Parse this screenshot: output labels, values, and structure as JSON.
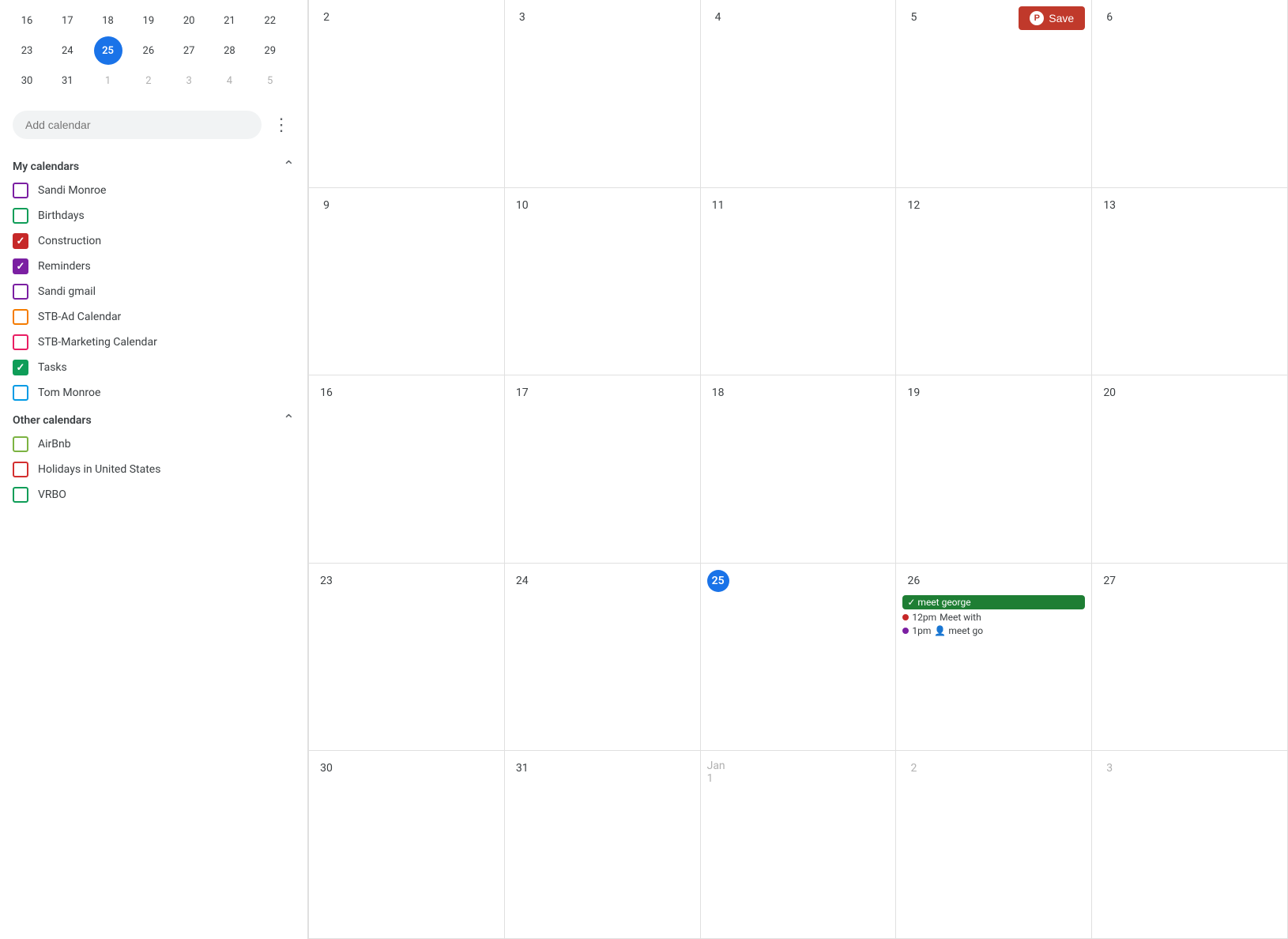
{
  "sidebar": {
    "mini_calendar": {
      "rows": [
        [
          16,
          17,
          18,
          19,
          20,
          21,
          22
        ],
        [
          23,
          24,
          25,
          26,
          27,
          28,
          29
        ],
        [
          30,
          31,
          1,
          2,
          3,
          4,
          5
        ]
      ],
      "today": 25,
      "other_month_start": [
        1,
        2,
        3,
        4,
        5
      ]
    },
    "add_calendar_placeholder": "Add calendar",
    "my_calendars_label": "My calendars",
    "my_calendars": [
      {
        "id": "sandi-monroe",
        "label": "Sandi Monroe",
        "color": "#7b1fa2",
        "checked": false
      },
      {
        "id": "birthdays",
        "label": "Birthdays",
        "color": "#0f9d58",
        "checked": false
      },
      {
        "id": "construction",
        "label": "Construction",
        "color": "#c62828",
        "checked": true
      },
      {
        "id": "reminders",
        "label": "Reminders",
        "color": "#7b1fa2",
        "checked": true
      },
      {
        "id": "sandi-gmail",
        "label": "Sandi gmail",
        "color": "#7b1fa2",
        "checked": false
      },
      {
        "id": "stb-ad-calendar",
        "label": "STB-Ad Calendar",
        "color": "#f57c00",
        "checked": false
      },
      {
        "id": "stb-marketing-calendar",
        "label": "STB-Marketing Calendar",
        "color": "#e91e63",
        "checked": false
      },
      {
        "id": "tasks",
        "label": "Tasks",
        "color": "#0f9d58",
        "checked": true
      },
      {
        "id": "tom-monroe",
        "label": "Tom Monroe",
        "color": "#039be5",
        "checked": false
      }
    ],
    "other_calendars_label": "Other calendars",
    "other_calendars": [
      {
        "id": "airbnb",
        "label": "AirBnb",
        "color": "#7cb342",
        "checked": false
      },
      {
        "id": "holidays-us",
        "label": "Holidays in United States",
        "color": "#d32f2f",
        "checked": false
      },
      {
        "id": "vrbo",
        "label": "VRBO",
        "color": "#0f9d58",
        "checked": false
      }
    ]
  },
  "calendar": {
    "save_button_label": "Save",
    "pinterest_symbol": "P",
    "rows": [
      [
        {
          "num": 2,
          "today": false,
          "other": false
        },
        {
          "num": 3,
          "today": false,
          "other": false
        },
        {
          "num": 4,
          "today": false,
          "other": false
        },
        {
          "num": 5,
          "today": false,
          "other": false,
          "has_save": true
        },
        {
          "num": 6,
          "today": false,
          "other": false
        }
      ],
      [
        {
          "num": 9,
          "today": false,
          "other": false
        },
        {
          "num": 10,
          "today": false,
          "other": false
        },
        {
          "num": 11,
          "today": false,
          "other": false
        },
        {
          "num": 12,
          "today": false,
          "other": false
        },
        {
          "num": 13,
          "today": false,
          "other": false
        }
      ],
      [
        {
          "num": 16,
          "today": false,
          "other": false
        },
        {
          "num": 17,
          "today": false,
          "other": false
        },
        {
          "num": 18,
          "today": false,
          "other": false
        },
        {
          "num": 19,
          "today": false,
          "other": false
        },
        {
          "num": 20,
          "today": false,
          "other": false
        }
      ],
      [
        {
          "num": 23,
          "today": false,
          "other": false
        },
        {
          "num": 24,
          "today": false,
          "other": false
        },
        {
          "num": 25,
          "today": true,
          "other": false
        },
        {
          "num": 26,
          "today": false,
          "other": false,
          "has_events": true
        },
        {
          "num": 27,
          "today": false,
          "other": false
        }
      ],
      [
        {
          "num": 30,
          "today": false,
          "other": false
        },
        {
          "num": 31,
          "today": false,
          "other": false
        },
        {
          "num": "Jan 1",
          "today": false,
          "other": true
        },
        {
          "num": 2,
          "today": false,
          "other": true
        },
        {
          "num": 3,
          "today": false,
          "other": true
        }
      ]
    ],
    "events": {
      "26": {
        "chips": [
          {
            "label": "✓ meet george",
            "color": "#1e7e34"
          }
        ],
        "dots": [
          {
            "time": "12pm",
            "label": "Meet with",
            "color": "#c62828"
          },
          {
            "time": "1pm",
            "label": "meet go",
            "color": "#7b1fa2",
            "icon": "👤"
          }
        ]
      }
    }
  }
}
